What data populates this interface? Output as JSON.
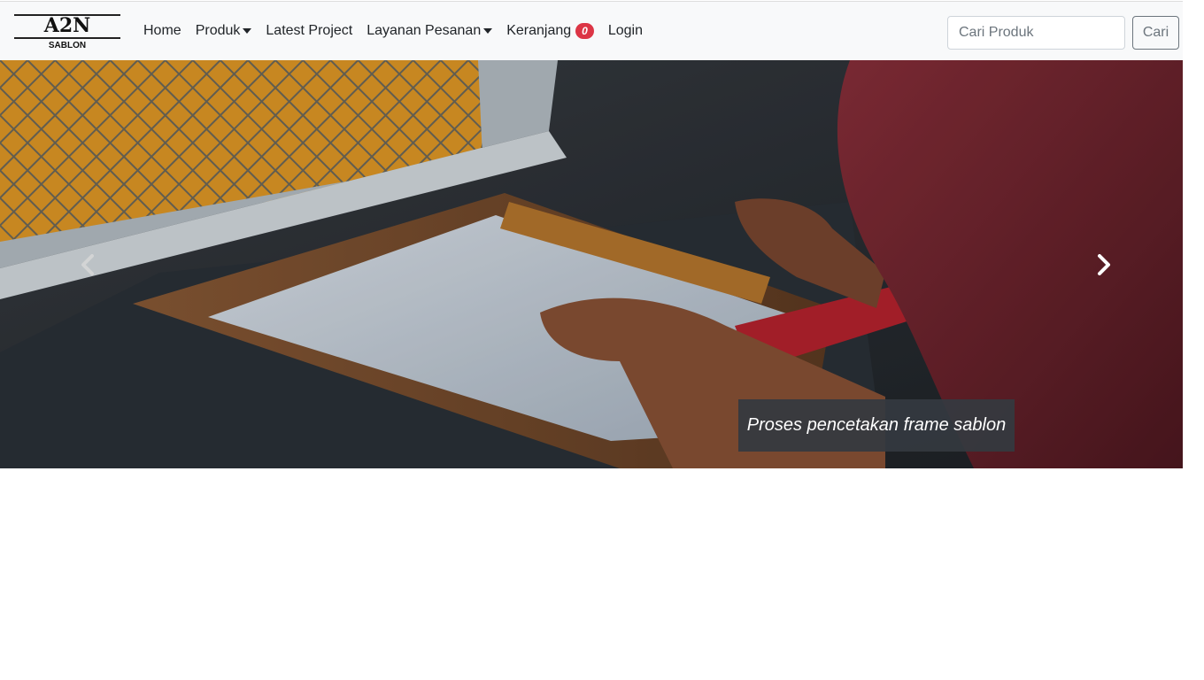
{
  "brand": {
    "title": "A2N",
    "subtitle": "SABLON"
  },
  "nav": {
    "home": "Home",
    "produk": "Produk",
    "latest_project": "Latest Project",
    "layanan_pesanan": "Layanan Pesanan",
    "keranjang": "Keranjang",
    "cart_count": "0",
    "login": "Login"
  },
  "search": {
    "placeholder": "Cari Produk",
    "value": "",
    "button_label": "Cari"
  },
  "carousel": {
    "caption": "Proses pencetakan frame sablon",
    "prev_icon": "chevron-left-icon",
    "next_icon": "chevron-right-icon"
  },
  "colors": {
    "navbar_bg": "#f8f9fa",
    "badge": "#dc3545",
    "caption_bg": "#343a40",
    "button_outline": "#6c757d"
  }
}
